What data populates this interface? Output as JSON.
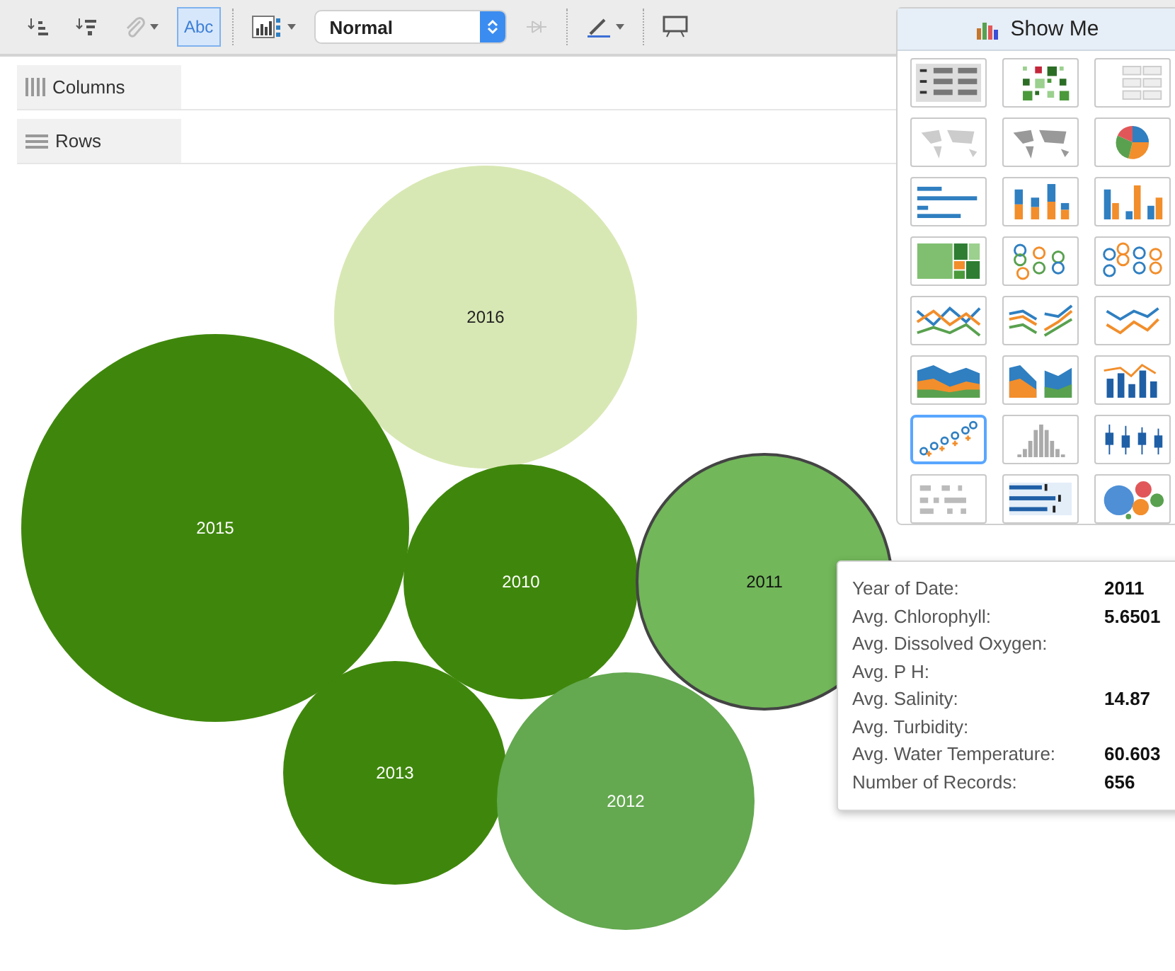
{
  "toolbar": {
    "items": [
      {
        "kind": "sort-ascending",
        "dropdown": false
      },
      {
        "kind": "sort-descending",
        "dropdown": false
      },
      {
        "kind": "paperclip",
        "dropdown": true
      },
      {
        "kind": "text",
        "label": "Abc",
        "selected": true
      },
      {
        "kind": "chart-type",
        "dropdown": true
      },
      {
        "kind": "select",
        "value": "Normal"
      },
      {
        "kind": "pin",
        "disabled": true
      },
      {
        "kind": "pen",
        "dropdown": true
      },
      {
        "kind": "presentation",
        "dropdown": false
      }
    ]
  },
  "shelves": [
    {
      "kind": "columns",
      "label": "Columns"
    },
    {
      "kind": "rows",
      "label": "Rows"
    }
  ],
  "bubbles": [
    {
      "label": "2016",
      "color": "#d8e8b4",
      "selected": false
    },
    {
      "label": "2015",
      "color": "#3f870c",
      "selected": false
    },
    {
      "label": "2010",
      "color": "#3f870c",
      "selected": false
    },
    {
      "label": "2011",
      "color": "#72b75a",
      "selected": true
    },
    {
      "label": "2013",
      "color": "#3f870c",
      "selected": false
    },
    {
      "label": "2012",
      "color": "#64a850",
      "selected": false
    }
  ],
  "show_me": {
    "title": "Show Me",
    "thumbnails": [
      {
        "kind": "text-table",
        "selected": false
      },
      {
        "kind": "heat-map",
        "selected": false
      },
      {
        "kind": "highlight-table",
        "selected": false
      },
      {
        "kind": "symbol-map",
        "selected": false
      },
      {
        "kind": "filled-map",
        "selected": false
      },
      {
        "kind": "pie",
        "selected": false
      },
      {
        "kind": "horizontal-bar",
        "selected": false
      },
      {
        "kind": "stacked-bar",
        "selected": false
      },
      {
        "kind": "side-by-side-bar",
        "selected": false
      },
      {
        "kind": "treemap",
        "selected": false
      },
      {
        "kind": "circle-view",
        "selected": false
      },
      {
        "kind": "side-by-side-circle",
        "selected": false
      },
      {
        "kind": "line",
        "selected": false
      },
      {
        "kind": "split-line",
        "selected": false
      },
      {
        "kind": "dual-line",
        "selected": false
      },
      {
        "kind": "area",
        "selected": false
      },
      {
        "kind": "split-area",
        "selected": false
      },
      {
        "kind": "combination",
        "selected": false
      },
      {
        "kind": "scatter",
        "selected": true
      },
      {
        "kind": "histogram",
        "selected": false
      },
      {
        "kind": "box-plot",
        "selected": false
      },
      {
        "kind": "gantt",
        "selected": false
      },
      {
        "kind": "bullet",
        "selected": false
      },
      {
        "kind": "packed-bubbles",
        "selected": false
      }
    ]
  },
  "tooltip": {
    "rows": [
      {
        "label": "Year of Date:",
        "value": "2011"
      },
      {
        "label": "Avg. Chlorophyll:",
        "value": "5.6501"
      },
      {
        "label": "Avg. Dissolved Oxygen:"
      },
      {
        "label": "Avg. P H:"
      },
      {
        "label": "Avg. Salinity:",
        "value": "14.87"
      },
      {
        "label": "Avg. Turbidity:"
      },
      {
        "label": "Avg. Water Temperature:",
        "value": "60.603"
      },
      {
        "label": "Number of Records:",
        "value": "656"
      }
    ]
  }
}
